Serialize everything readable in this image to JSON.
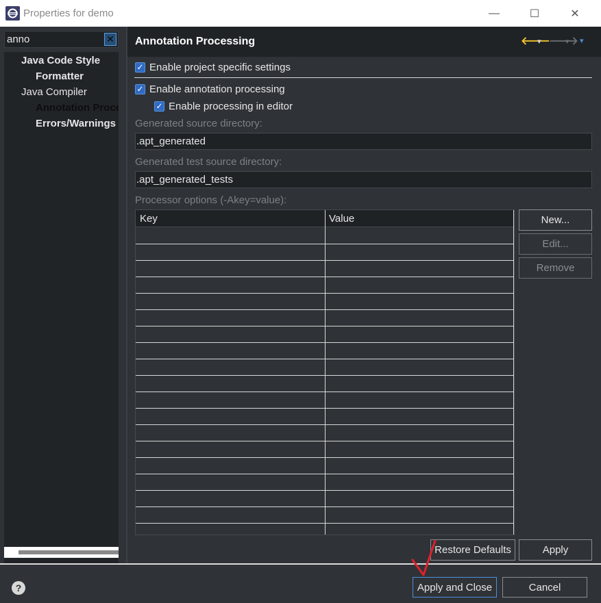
{
  "window": {
    "title": "Properties for demo",
    "minimize_glyph": "—",
    "maximize_glyph": "☐",
    "close_glyph": "✕"
  },
  "filter": {
    "value": "anno",
    "clear_glyph": "✕"
  },
  "tree": {
    "items": [
      {
        "label": "Java Code Style"
      },
      {
        "label": "Formatter"
      },
      {
        "label": "Java Compiler"
      },
      {
        "label": "Annotation Processing"
      },
      {
        "label": "Errors/Warnings"
      }
    ]
  },
  "page": {
    "title": "Annotation Processing",
    "nav": {
      "back_glyph": "🡐",
      "dropdown_glyph": "▾",
      "forward_glyph": "🡒",
      "menu_glyph": "▾"
    },
    "project_specific": {
      "label": "Enable project specific settings",
      "checked": true
    },
    "annotation_processing": {
      "label": "Enable annotation processing",
      "checked": true
    },
    "processing_in_editor": {
      "label": "Enable processing in editor",
      "checked": true
    },
    "gen_source_dir": {
      "label": "Generated source directory:",
      "value": ".apt_generated"
    },
    "gen_test_source_dir": {
      "label": "Generated test source directory:",
      "value": ".apt_generated_tests"
    },
    "processor_options": {
      "label": "Processor options (-Akey=value):",
      "columns": [
        "Key",
        "Value"
      ],
      "buttons": {
        "new": "New...",
        "edit": "Edit...",
        "remove": "Remove"
      }
    },
    "restore_defaults": "Restore Defaults",
    "apply": "Apply"
  },
  "footer": {
    "help_glyph": "?",
    "apply_and_close": "Apply and Close",
    "cancel": "Cancel"
  },
  "colors": {
    "accent": "#2f6bc4",
    "checkmark_annotation": "#e0202a",
    "back_arrow": "#f2c22b"
  }
}
